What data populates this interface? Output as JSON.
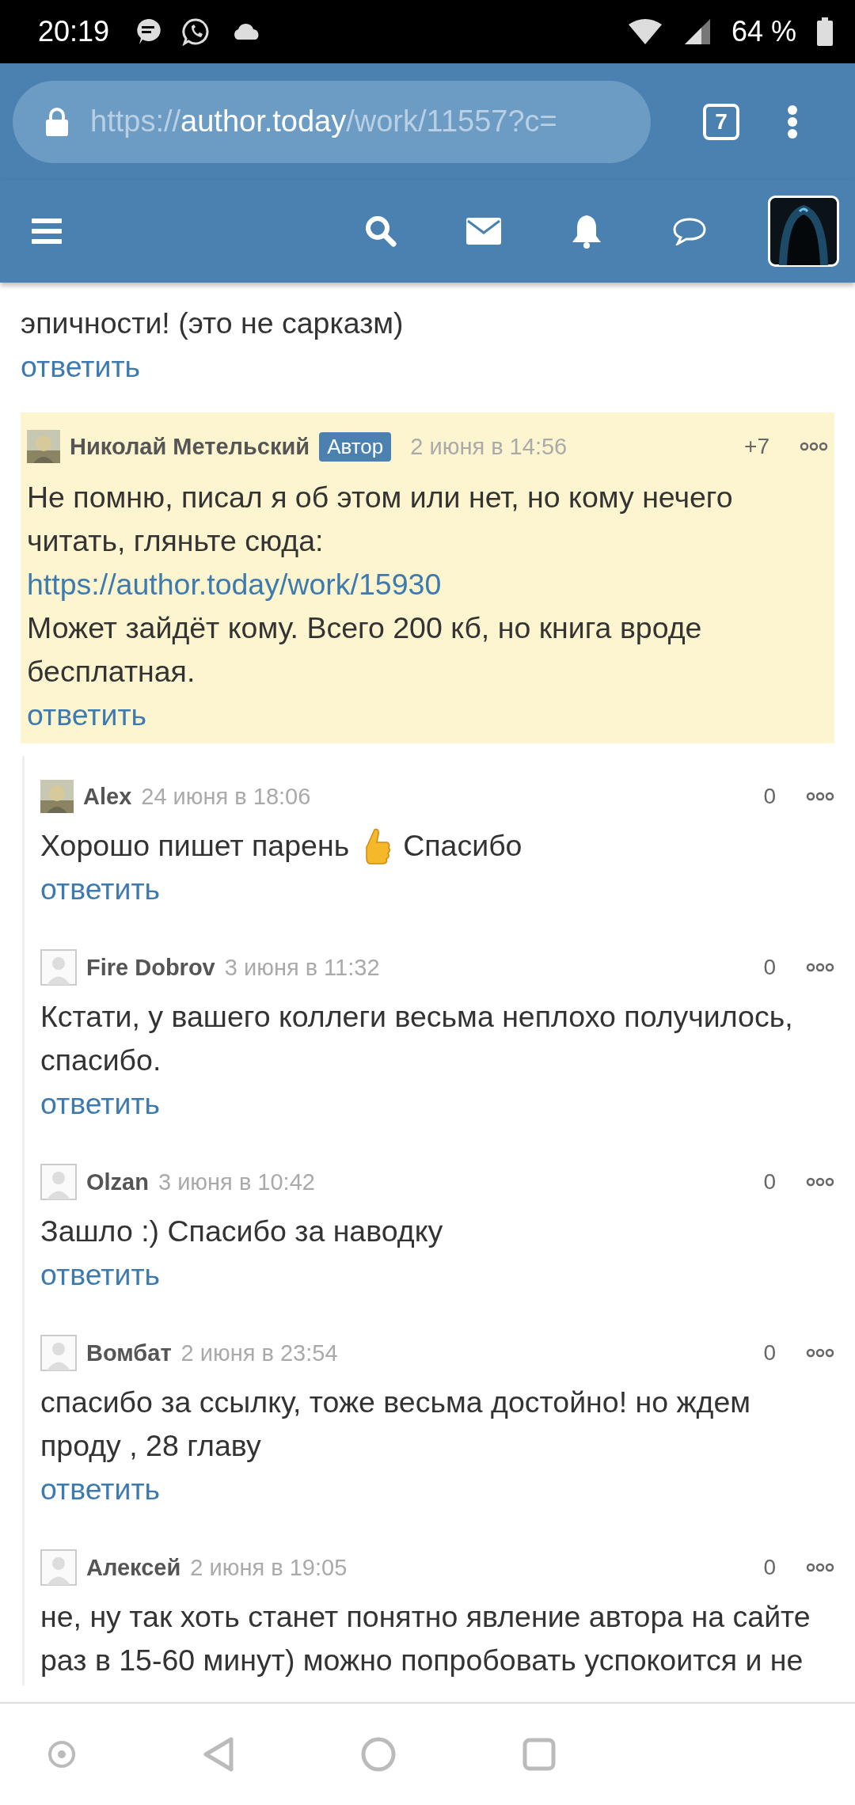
{
  "status_bar": {
    "time": "20:19",
    "battery": "64 %"
  },
  "browser": {
    "url_scheme": "https://",
    "url_host": "author.today",
    "url_path": "/work/11557?c=",
    "tab_count": "7"
  },
  "previous_comment": {
    "text": "эпичности! (это не сарказм)",
    "reply": "ответить"
  },
  "thread": {
    "author": "Николай Метельский",
    "default_avatar": false,
    "badge": "Автор",
    "date": "2 июня в 14:56",
    "score": "+7",
    "highlighted": true,
    "body": [
      {
        "kind": "text",
        "text": "Не помню, писал я об этом или нет, но кому нечего читать, гляньте сюда:"
      },
      {
        "kind": "link",
        "text": "https://author.today/work/15930"
      },
      {
        "kind": "text",
        "text": "Может зайдёт кому. Всего 200 кб, но книга вроде бесплатная."
      }
    ],
    "reply": "ответить",
    "children": [
      {
        "author": "Alex",
        "default_avatar": false,
        "date": "24 июня в 18:06",
        "score": "0",
        "highlighted": false,
        "body": [
          {
            "kind": "text",
            "text": "Хорошо пишет парень"
          },
          {
            "kind": "thumbs"
          },
          {
            "kind": "text",
            "text": "Спасибо"
          }
        ],
        "reply": "ответить"
      },
      {
        "author": "Fire Dobrov",
        "default_avatar": true,
        "date": "3 июня в 11:32",
        "score": "0",
        "highlighted": false,
        "body": [
          {
            "kind": "text",
            "text": "Кстати, у вашего коллеги весьма неплохо получилось, спасибо."
          }
        ],
        "reply": "ответить"
      },
      {
        "author": "Olzan",
        "default_avatar": true,
        "date": "3 июня в 10:42",
        "score": "0",
        "highlighted": false,
        "body": [
          {
            "kind": "text",
            "text": "Зашло :) Спасибо за наводку"
          }
        ],
        "reply": "ответить"
      },
      {
        "author": "Вомбат",
        "default_avatar": true,
        "date": "2 июня в 23:54",
        "score": "0",
        "highlighted": false,
        "body": [
          {
            "kind": "text",
            "text": "спасибо за ссылку, тоже весьма достойно! но ждем проду , 28 главу"
          }
        ],
        "reply": "ответить"
      },
      {
        "author": "Алексей",
        "default_avatar": true,
        "date": "2 июня в 19:05",
        "score": "0",
        "highlighted": false,
        "body": [
          {
            "kind": "text",
            "text": "не, ну так хоть станет понятно явление автора на сайте раз в 15-60 минут) можно попробовать успокоится и не"
          }
        ]
      }
    ]
  }
}
